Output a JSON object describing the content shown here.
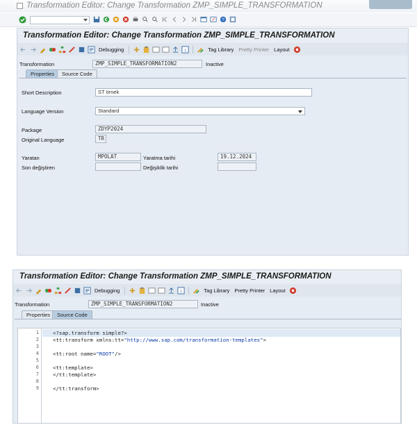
{
  "window_title": "Transformation Editor: Change Transformation ZMP_SIMPLE_TRANSFORMATION",
  "screen_title": "Transformation Editor: Change Transformation ZMP_SIMPLE_TRANSFORMATION",
  "toolbar": {
    "debugging": "Debugging",
    "tag_library": "Tag Library",
    "pretty_printer": "Pretty Printer",
    "layout": "Layout"
  },
  "header": {
    "transformation_label": "Transformation",
    "transformation_value": "ZMP_SIMPLE_TRANSFORMATION2",
    "status": "Inactive"
  },
  "tabs": [
    "Properties",
    "Source Code"
  ],
  "properties": {
    "short_description_label": "Short Description",
    "short_description_value": "ST örnek",
    "language_version_label": "Language Version",
    "language_version_value": "Standard",
    "package_label": "Package",
    "package_value": "ZDYP2024",
    "original_language_label": "Original Language",
    "original_language_value": "TR",
    "created_by_label": "Yaratan",
    "created_by_value": "MPOLAT",
    "created_on_label": "Yaratma tarihi",
    "created_on_value": "19.12.2024",
    "changed_by_label": "Son değiştiren",
    "changed_by_value": "",
    "changed_on_label": "Değişiklik tarihi",
    "changed_on_value": ""
  },
  "source_code": {
    "line_numbers": [
      "1",
      "2",
      "3",
      "4",
      "5",
      "6",
      "7",
      "8",
      "9"
    ],
    "lines": [
      "<?sap.transform simple?>",
      "<tt:transform xmlns:tt=",
      "",
      "<tt:root name=",
      "",
      "<tt:template>",
      "</tt:template>",
      "",
      "</tt:transform>"
    ],
    "xmlns_value": "\"http://www.sap.com/transformation-templates\"",
    "line2_end": ">",
    "root_name_value": "\"ROOT\"",
    "line4_end": "/>"
  },
  "colors": {
    "accent": "#b7cde2",
    "panel": "#e6ecf3",
    "code_string": "#0b3aa6"
  }
}
